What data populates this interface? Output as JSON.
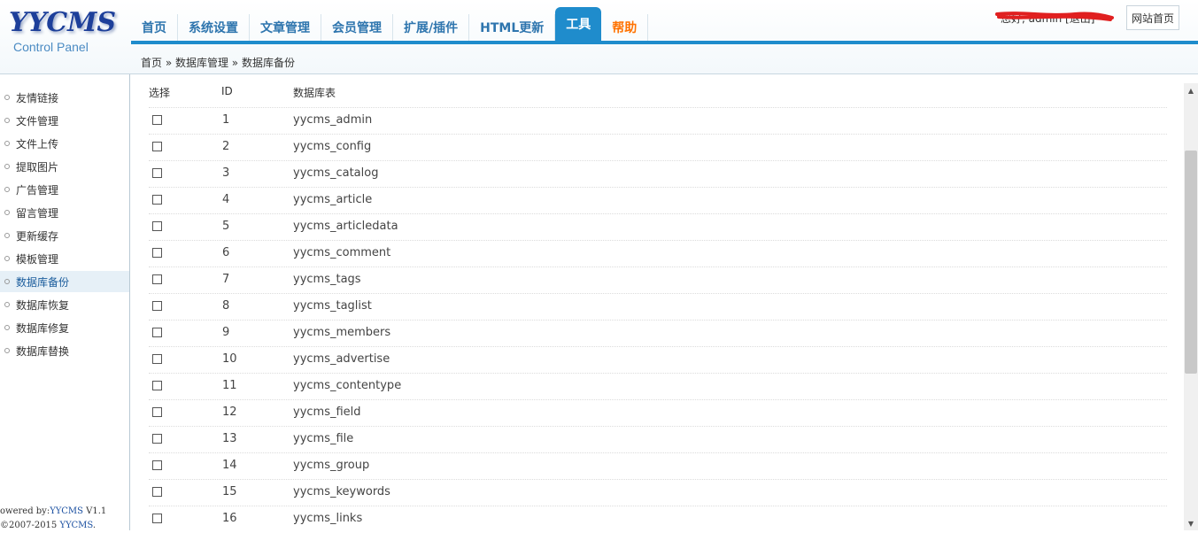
{
  "logo": {
    "main": "YYCMS",
    "sub": "Control Panel"
  },
  "nav": {
    "items": [
      "首页",
      "系统设置",
      "文章管理",
      "会员管理",
      "扩展/插件",
      "HTML更新",
      "工具",
      "帮助"
    ],
    "active_index": 6
  },
  "user": {
    "greeting": "您好, admin [退出]"
  },
  "home_button": "网站首页",
  "breadcrumb": "首页 » 数据库管理 » 数据库备份",
  "sidebar": {
    "items": [
      "友情链接",
      "文件管理",
      "文件上传",
      "提取图片",
      "广告管理",
      "留言管理",
      "更新缓存",
      "模板管理",
      "数据库备份",
      "数据库恢复",
      "数据库修复",
      "数据库替换"
    ],
    "active_index": 8
  },
  "footer": {
    "powered_prefix": "owered by:",
    "powered_link": "YYCMS",
    "version": " V1.1",
    "copyright_prefix": "2007-2015 ",
    "copyright_link": "YYCMS",
    "copyright_suffix": "."
  },
  "table": {
    "headers": {
      "select": "选择",
      "id": "ID",
      "name": "数据库表"
    },
    "rows": [
      {
        "id": "1",
        "name": "yycms_admin"
      },
      {
        "id": "2",
        "name": "yycms_config"
      },
      {
        "id": "3",
        "name": "yycms_catalog"
      },
      {
        "id": "4",
        "name": "yycms_article"
      },
      {
        "id": "5",
        "name": "yycms_articledata"
      },
      {
        "id": "6",
        "name": "yycms_comment"
      },
      {
        "id": "7",
        "name": "yycms_tags"
      },
      {
        "id": "8",
        "name": "yycms_taglist"
      },
      {
        "id": "9",
        "name": "yycms_members"
      },
      {
        "id": "10",
        "name": "yycms_advertise"
      },
      {
        "id": "11",
        "name": "yycms_contentype"
      },
      {
        "id": "12",
        "name": "yycms_field"
      },
      {
        "id": "13",
        "name": "yycms_file"
      },
      {
        "id": "14",
        "name": "yycms_group"
      },
      {
        "id": "15",
        "name": "yycms_keywords"
      },
      {
        "id": "16",
        "name": "yycms_links"
      }
    ]
  },
  "colors": {
    "accent": "#1f8ccc",
    "nav_text": "#2e75ae",
    "help": "#ff7200",
    "redaction": "#e02020"
  }
}
